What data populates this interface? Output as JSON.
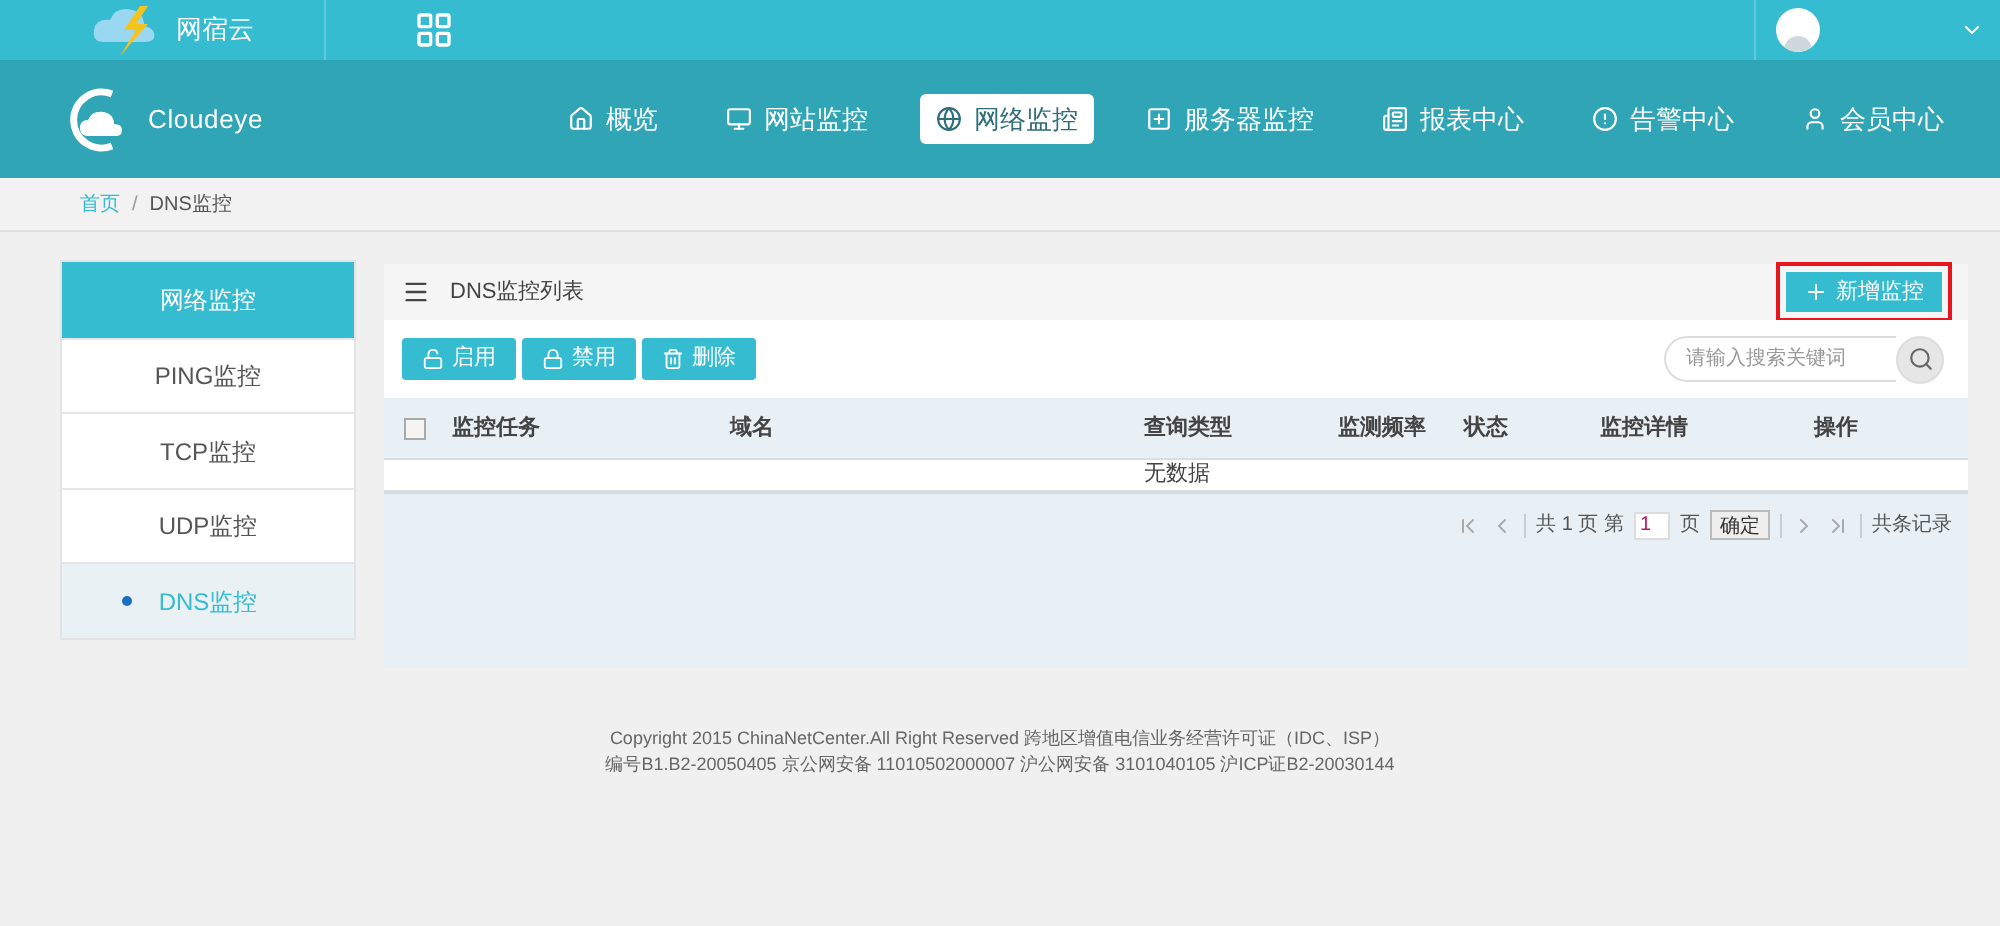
{
  "top_bar": {
    "brand": "网宿云"
  },
  "nav": {
    "logo": "Cloudeye",
    "items": [
      {
        "label": "概览",
        "selected": false
      },
      {
        "label": "网站监控",
        "selected": false
      },
      {
        "label": "网络监控",
        "selected": true
      },
      {
        "label": "服务器监控",
        "selected": false
      },
      {
        "label": "报表中心",
        "selected": false
      },
      {
        "label": "告警中心",
        "selected": false
      },
      {
        "label": "会员中心",
        "selected": false
      }
    ]
  },
  "breadcrumb": {
    "separator": "/",
    "items": [
      {
        "label": "首页",
        "link": true
      },
      {
        "label": "DNS监控",
        "link": false
      }
    ]
  },
  "sidebar": {
    "title": "网络监控",
    "items": [
      {
        "label": "PING监控",
        "selected": false
      },
      {
        "label": "TCP监控",
        "selected": false
      },
      {
        "label": "UDP监控",
        "selected": false
      },
      {
        "label": "DNS监控",
        "selected": true
      }
    ]
  },
  "panel": {
    "title": "DNS监控列表",
    "add_button": {
      "label": "新增监控",
      "highlighted": true
    },
    "actions": [
      {
        "label": "启用"
      },
      {
        "label": "禁用"
      },
      {
        "label": "删除"
      }
    ],
    "search": {
      "placeholder": "请输入搜索关键词"
    },
    "table": {
      "all_checked": false,
      "columns": [
        "监控任务",
        "域名",
        "查询类型",
        "监测频率",
        "状态",
        "监控详情",
        "操作"
      ],
      "empty": "无数据"
    },
    "pagination": {
      "total_pages_before": "共",
      "total_pages": "1",
      "pages_label": "页",
      "page_before": "第",
      "page": "1",
      "page_after": "页",
      "confirm": "确定",
      "records": "共条记录"
    }
  },
  "footer": [
    "Copyright 2015 ChinaNetCenter.All Right Reserved 跨地区增值电信业务经营许可证（IDC、ISP）",
    "编号B1.B2-20050405 京公网安备 11010502000007 沪公网安备 3101040105 沪ICP证B2-20030144"
  ]
}
